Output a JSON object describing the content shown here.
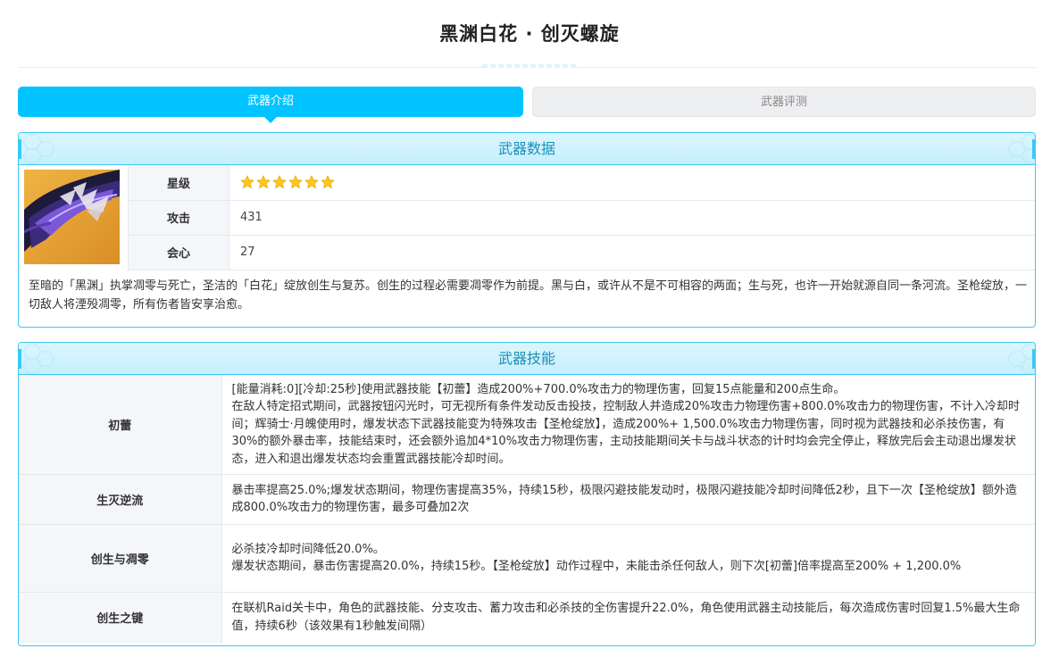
{
  "page": {
    "title": "黑渊白花 · 创灭螺旋"
  },
  "tabs": [
    {
      "label": "武器介绍",
      "active": true
    },
    {
      "label": "武器评测",
      "active": false
    }
  ],
  "weapon_data": {
    "header": "武器数据",
    "image_icon": "weapon-image",
    "stats": [
      {
        "label": "星级",
        "value": "",
        "stars": 6
      },
      {
        "label": "攻击",
        "value": "431"
      },
      {
        "label": "会心",
        "value": "27"
      }
    ],
    "description": "至暗的「黑渊」执掌凋零与死亡，圣洁的「白花」绽放创生与复苏。创生的过程必需要凋零作为前提。黑与白，或许从不是不可相容的两面；生与死，也许一开始就源自同一条河流。圣枪绽放，一切敌人将湮殁凋零，所有伤者皆安享治愈。"
  },
  "weapon_skills": {
    "header": "武器技能",
    "skills": [
      {
        "name": "初蕾",
        "lines": [
          "[能量消耗:0][冷却:25秒]使用武器技能【初蕾】造成200%+700.0%攻击力的物理伤害，回复15点能量和200点生命。",
          "在敌人特定招式期间，武器按钮闪光时，可无视所有条件发动反击投技，控制敌人并造成20%攻击力物理伤害+800.0%攻击力的物理伤害，不计入冷却时间；辉骑士·月魄使用时，爆发状态下武器技能变为特殊攻击【圣枪绽放】，造成200%+ 1,500.0%攻击力物理伤害，同时视为武器技和必杀技伤害，有30%的额外暴击率，技能结束时，还会额外追加4*10%攻击力物理伤害，主动技能期间关卡与战斗状态的计时均会完全停止，释放完后会主动退出爆发状态，进入和退出爆发状态均会重置武器技能冷却时间。"
        ]
      },
      {
        "name": "生灭逆流",
        "lines": [
          "暴击率提高25.0%;爆发状态期间，物理伤害提高35%，持续15秒，极限闪避技能发动时，极限闪避技能冷却时间降低2秒，且下一次【圣枪绽放】额外造成800.0%攻击力的物理伤害，最多可叠加2次"
        ]
      },
      {
        "name": "创生与凋零",
        "lines": [
          "必杀技冷却时间降低20.0%。",
          "爆发状态期间，暴击伤害提高20.0%，持续15秒。【圣枪绽放】动作过程中，未能击杀任何敌人，则下次[初蕾]倍率提高至200% + 1,200.0%"
        ]
      },
      {
        "name": "创生之键",
        "lines": [
          "在联机Raid关卡中，角色的武器技能、分支攻击、蓄力攻击和必杀技的全伤害提升22.0%，角色使用武器主动技能后，每次造成伤害时回复1.5%最大生命值，持续6秒（该效果有1秒触发间隔）"
        ]
      }
    ]
  },
  "colors": {
    "accent": "#00c3ff",
    "panel_border": "#3cc8f2",
    "header_text": "#1a8fb8",
    "star": "#ffc81e"
  }
}
